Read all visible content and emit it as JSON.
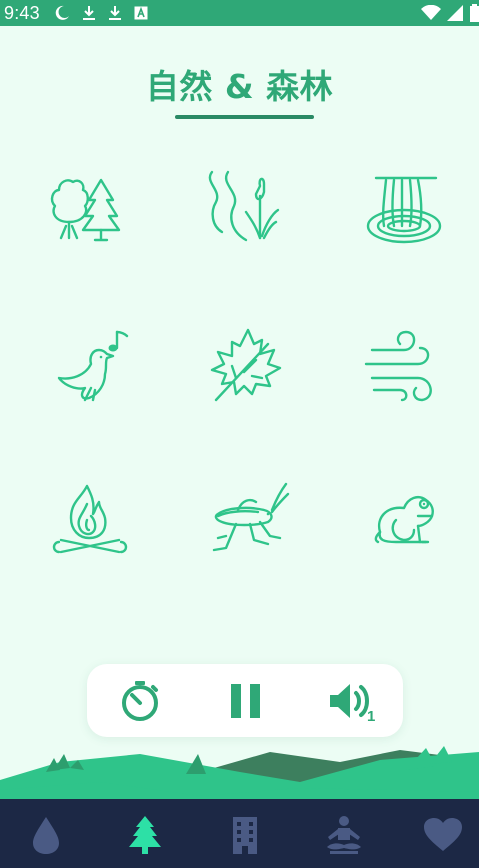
{
  "status_bar": {
    "time": "9:43",
    "left_icons": [
      "moon-icon",
      "download-icon",
      "download-icon",
      "text-recognition-icon"
    ],
    "right_icons": [
      "wifi-icon",
      "signal-icon",
      "battery-icon"
    ]
  },
  "title": "自然 & 森林",
  "sounds": [
    {
      "name": "forest-trees-icon"
    },
    {
      "name": "river-reeds-icon"
    },
    {
      "name": "waterfall-icon"
    },
    {
      "name": "bird-singing-icon"
    },
    {
      "name": "maple-leaf-icon"
    },
    {
      "name": "wind-icon"
    },
    {
      "name": "campfire-icon"
    },
    {
      "name": "cricket-icon"
    },
    {
      "name": "frog-icon"
    }
  ],
  "controls": {
    "timer_icon": "timer-icon",
    "pause_icon": "pause-icon",
    "volume_icon": "volume-icon",
    "volume_badge": "1"
  },
  "nav": {
    "items": [
      {
        "icon": "water-drop-icon",
        "active": false
      },
      {
        "icon": "pine-tree-icon",
        "active": true
      },
      {
        "icon": "city-building-icon",
        "active": false
      },
      {
        "icon": "meditation-icon",
        "active": false
      },
      {
        "icon": "heart-icon",
        "active": false
      }
    ]
  },
  "colors": {
    "background": "#ecfdf4",
    "status_bar": "#2fa877",
    "accent": "#2fc48a",
    "title": "#2fa877",
    "nav_background": "#1c2845",
    "nav_inactive": "#4a5a84",
    "nav_active": "#2de0a6"
  }
}
